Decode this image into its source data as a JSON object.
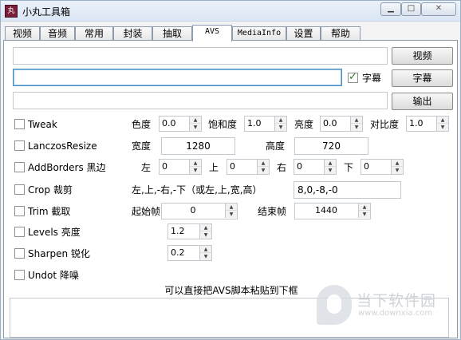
{
  "window": {
    "title": "小丸工具箱"
  },
  "tabs": [
    "视频",
    "音频",
    "常用",
    "封装",
    "抽取",
    "AVS",
    "MediaInfo",
    "设置",
    "帮助"
  ],
  "active_tab": "AVS",
  "top": {
    "video_button": "视频",
    "subtitle_checkbox": "字幕",
    "subtitle_button": "字幕",
    "output_button": "输出"
  },
  "filters": {
    "tweak": {
      "label": "Tweak",
      "hue_label": "色度",
      "hue": "0.0",
      "sat_label": "饱和度",
      "sat": "1.0",
      "bright_label": "亮度",
      "bright": "0.0",
      "cont_label": "对比度",
      "cont": "1.0"
    },
    "lanczos": {
      "label": "LanczosResize",
      "width_label": "宽度",
      "width": "1280",
      "height_label": "高度",
      "height": "720"
    },
    "addborders": {
      "label": "AddBorders 黑边",
      "left_label": "左",
      "left": "0",
      "top_label": "上",
      "top": "0",
      "right_label": "右",
      "right": "0",
      "bottom_label": "下",
      "bottom": "0"
    },
    "crop": {
      "label": "Crop 裁剪",
      "desc": "左,上,-右,-下（或左,上,宽,高）",
      "value": "8,0,-8,-0"
    },
    "trim": {
      "label": "Trim 截取",
      "start_label": "起始帧",
      "start": "0",
      "end_label": "结束帧",
      "end": "1440"
    },
    "levels": {
      "label": "Levels 亮度",
      "value": "1.2"
    },
    "sharpen": {
      "label": "Sharpen 锐化",
      "value": "0.2"
    },
    "undot": {
      "label": "Undot 降噪"
    }
  },
  "hint": "可以直接把AVS脚本粘贴到下框",
  "watermark": {
    "text": "当下软件园",
    "url": "www.downxia.com"
  }
}
